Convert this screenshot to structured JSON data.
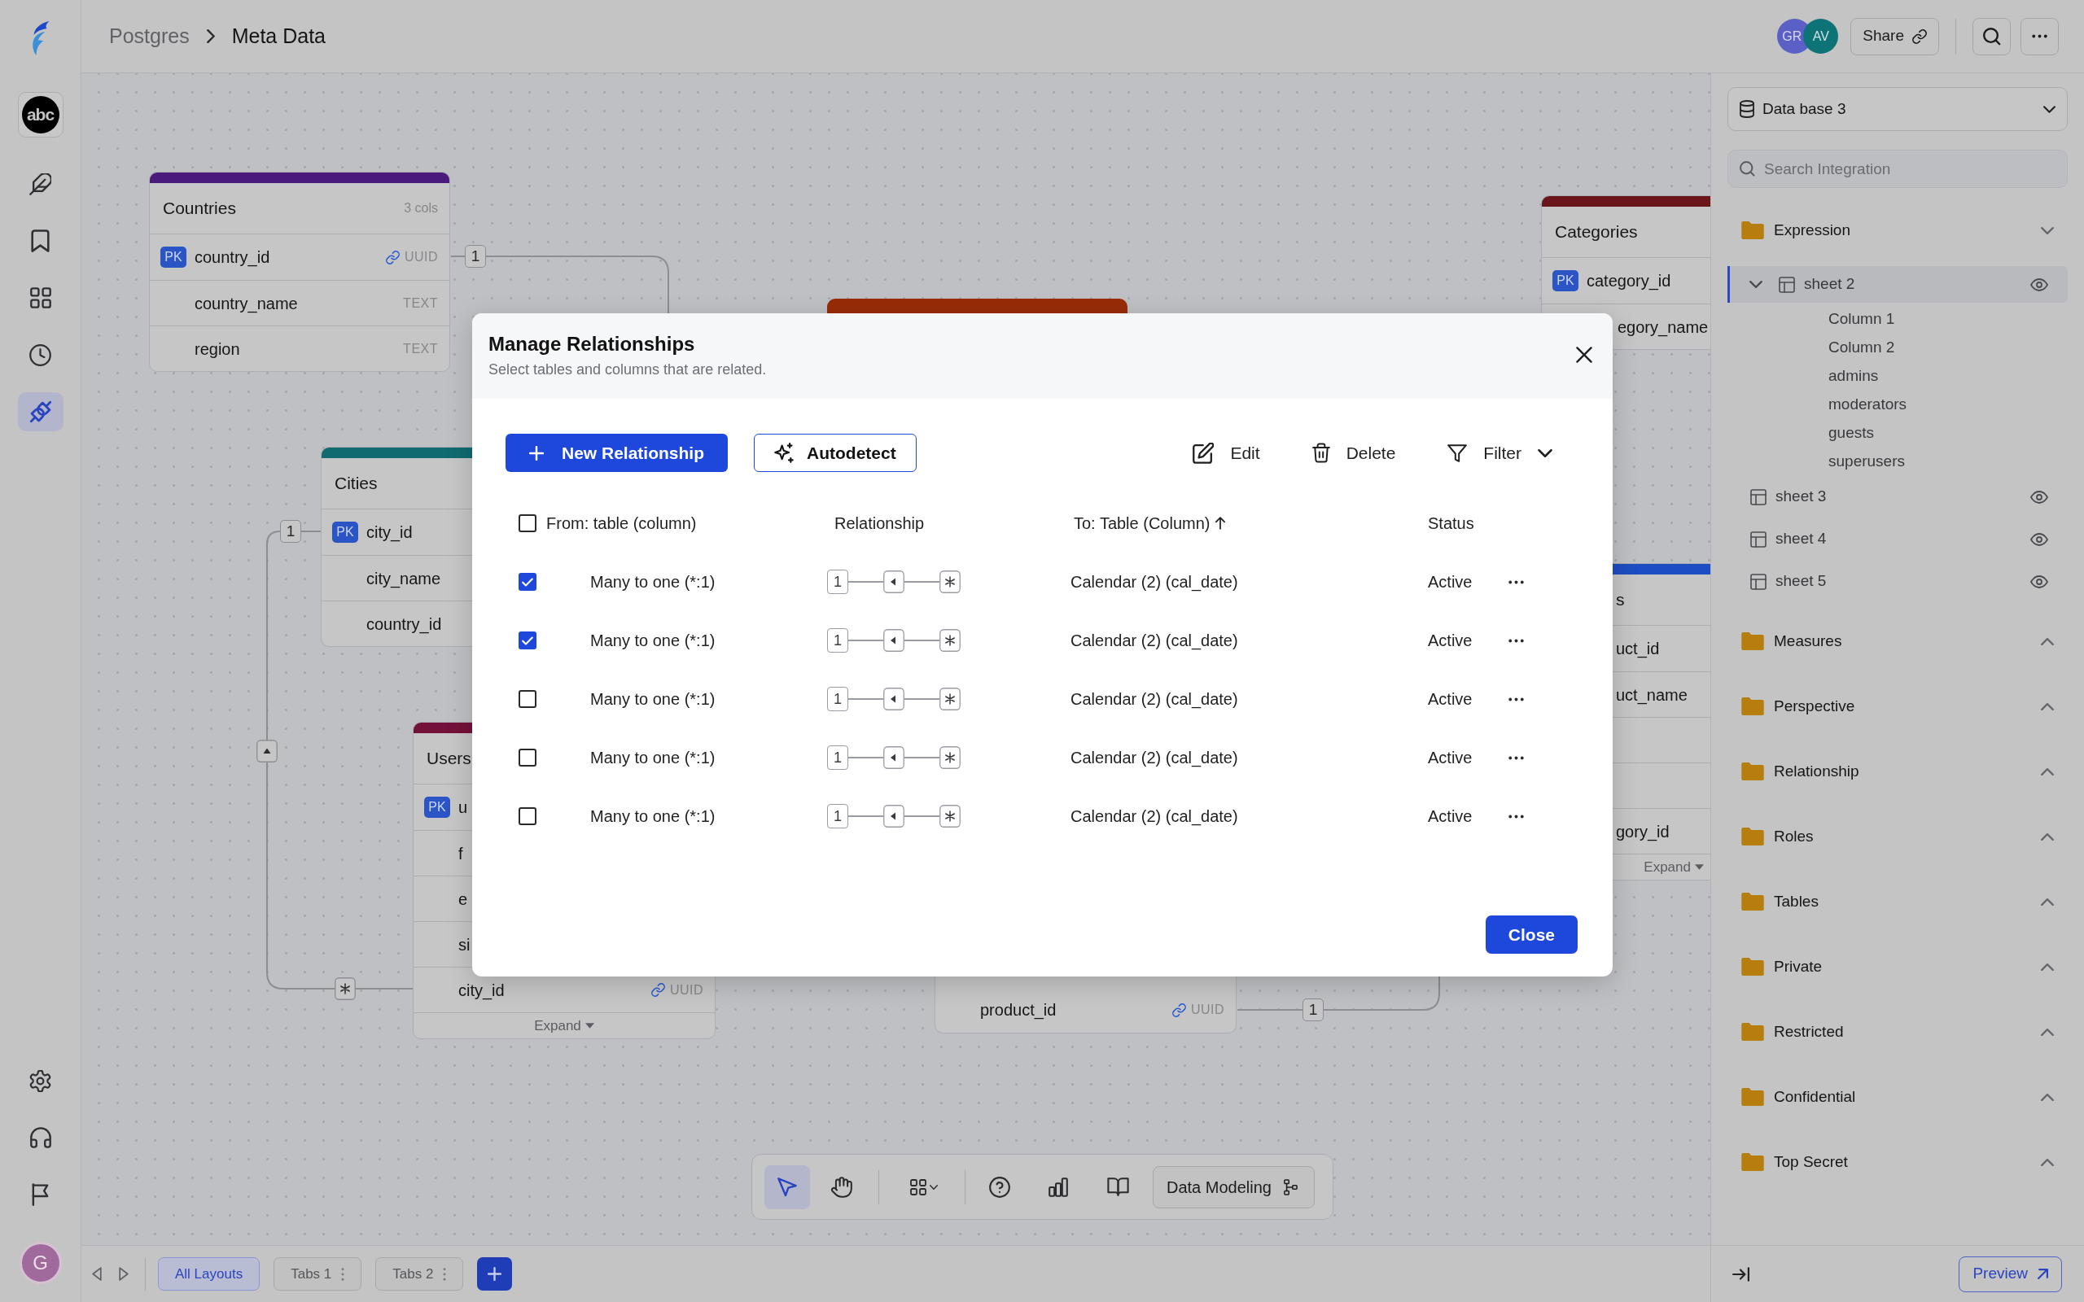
{
  "sidebar": {
    "workspace": "abc",
    "nav": [
      {
        "selected": false
      },
      {
        "selected": false
      },
      {
        "selected": false
      },
      {
        "selected": false
      },
      {
        "selected": true
      }
    ],
    "user_initial": "G"
  },
  "header": {
    "breadcrumb": [
      "Postgres",
      "Meta Data"
    ],
    "collaborators": [
      {
        "initials": "GR",
        "color": "#5a60c6"
      },
      {
        "initials": "AV",
        "color": "#0e7376"
      }
    ],
    "share_button": "Share"
  },
  "canvas": {
    "tables": [
      {
        "title": "Countries",
        "meta": "3 cols",
        "color": "#4a1b7d",
        "columns": [
          {
            "name": "country_id",
            "badge": "PK",
            "type": "UUID",
            "link": true
          },
          {
            "name": "country_name",
            "type": "TEXT"
          },
          {
            "name": "region",
            "type": "TEXT"
          }
        ]
      },
      {
        "title": "Cities",
        "color": "#0f6b70",
        "columns": [
          {
            "name": "city_id",
            "badge": "PK"
          },
          {
            "name": "city_name"
          },
          {
            "name": "country_id"
          }
        ]
      },
      {
        "title": "Users",
        "color": "#74113a",
        "columns": [
          {
            "name": "u",
            "badge": "PK"
          },
          {
            "name": "f"
          },
          {
            "name": "e"
          },
          {
            "name": "si"
          },
          {
            "name": "city_id",
            "type": "UUID",
            "link": true
          }
        ],
        "footer": "Expand"
      },
      {
        "color": "#982b08"
      },
      {
        "title": "Categories",
        "color": "#6a1519",
        "columns": [
          {
            "name": "category_id",
            "badge": "PK"
          },
          {
            "name": "egory_name"
          }
        ]
      },
      {
        "title": "s",
        "color": "#1d4dc2",
        "columns": [
          {
            "name": "uct_id"
          },
          {
            "name": "uct_name"
          },
          {},
          {},
          {
            "name": "gory_id"
          }
        ],
        "footer": "Expand"
      },
      {
        "columns": [
          {
            "name": "product_id",
            "type": "UUID",
            "link": true
          }
        ]
      }
    ],
    "connectors": [
      {
        "label": "1"
      },
      {
        "label": "1",
        "arrow_marker": true,
        "many_end": true
      },
      {
        "label": "1"
      }
    ],
    "toolbar": {
      "tools": [
        {
          "selected": true
        },
        {
          "selected": false
        },
        {
          "selected": false
        },
        {
          "selected": false
        },
        {
          "selected": false
        },
        {
          "selected": false
        }
      ],
      "mode_button": "Data Modeling"
    }
  },
  "layout_tabs": [
    {
      "label": "All Layouts",
      "selected": true,
      "menu": false
    },
    {
      "label": "Tabs 1",
      "selected": false,
      "menu": true
    },
    {
      "label": "Tabs 2",
      "selected": false,
      "menu": true
    }
  ],
  "right_panel": {
    "database": "Data base 3",
    "search": {
      "placeholder": "Search Integration"
    },
    "tree": [
      {
        "label": "Expression",
        "expanded": true,
        "children": [
          {
            "label": "sheet 2",
            "selected": true,
            "expanded": true,
            "children": [
              {
                "label": "Column 1"
              },
              {
                "label": "Column 2"
              },
              {
                "label": "admins"
              },
              {
                "label": "moderators"
              },
              {
                "label": "guests"
              },
              {
                "label": "superusers"
              }
            ]
          },
          {
            "label": "sheet 3",
            "selected": false,
            "expanded": false
          },
          {
            "label": "sheet 4",
            "selected": false,
            "expanded": false
          },
          {
            "label": "sheet 5",
            "selected": false,
            "expanded": false
          }
        ]
      },
      {
        "label": "Measures",
        "expanded": false
      },
      {
        "label": "Perspective",
        "expanded": false
      },
      {
        "label": "Relationship",
        "expanded": false
      },
      {
        "label": "Roles",
        "expanded": false
      },
      {
        "label": "Tables",
        "expanded": false
      },
      {
        "label": "Private",
        "expanded": false
      },
      {
        "label": "Restricted",
        "expanded": false
      },
      {
        "label": "Confidential",
        "expanded": false
      },
      {
        "label": "Top Secret",
        "expanded": false
      }
    ],
    "preview_button": "Preview"
  },
  "modal": {
    "title": "Manage Relationships",
    "subtitle": "Select tables and columns that are related.",
    "actions": [
      {
        "kind": "primary",
        "label": "New Relationship"
      },
      {
        "kind": "outline",
        "label": "Autodetect"
      },
      {
        "kind": "plain",
        "label": "Edit"
      },
      {
        "kind": "plain",
        "label": "Delete"
      },
      {
        "kind": "dropdown",
        "label": "Filter"
      }
    ],
    "select_all": {
      "checked": false
    },
    "columns": [
      {
        "label": "From: table (column)"
      },
      {
        "label": "Relationship"
      },
      {
        "label": "To: Table (Column)",
        "sorted": true
      },
      {
        "label": "Status"
      }
    ],
    "rows": [
      {
        "checked": true,
        "relationship_type": "Many to one (*:1)",
        "diagram_label": "1",
        "target": "Calendar (2) (cal_date)",
        "status": "Active"
      },
      {
        "checked": true,
        "relationship_type": "Many to one (*:1)",
        "diagram_label": "1",
        "target": "Calendar (2) (cal_date)",
        "status": "Active"
      },
      {
        "checked": false,
        "relationship_type": "Many to one (*:1)",
        "diagram_label": "1",
        "target": "Calendar (2) (cal_date)",
        "status": "Active"
      },
      {
        "checked": false,
        "relationship_type": "Many to one (*:1)",
        "diagram_label": "1",
        "target": "Calendar (2) (cal_date)",
        "status": "Active"
      },
      {
        "checked": false,
        "relationship_type": "Many to one (*:1)",
        "diagram_label": "1",
        "target": "Calendar (2) (cal_date)",
        "status": "Active"
      }
    ],
    "close_button": "Close"
  }
}
